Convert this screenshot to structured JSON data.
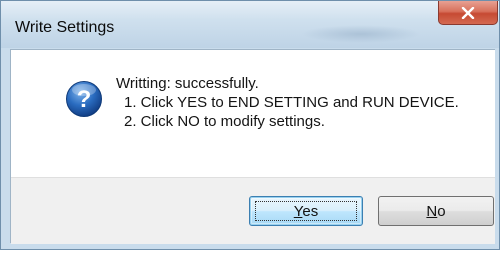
{
  "window": {
    "title": "Write Settings"
  },
  "dialog": {
    "icon": "question-icon",
    "message_lines": [
      "Writting: successfully.",
      "1. Click YES to END SETTING and RUN DEVICE.",
      "2. Click NO to modify settings."
    ]
  },
  "buttons": {
    "yes_mnemonic": "Y",
    "yes_rest": "es",
    "no_mnemonic": "N",
    "no_rest": "o"
  },
  "colors": {
    "titlebar": "#cfe0ee",
    "close_button": "#c64a33",
    "footer": "#f0f0f0",
    "icon_blue": "#1f5fb0"
  }
}
